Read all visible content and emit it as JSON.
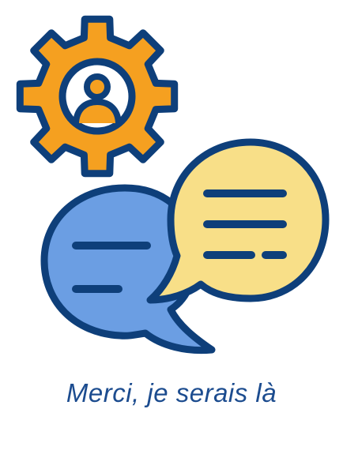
{
  "caption": {
    "text": "Merci, je serais là"
  },
  "icons": {
    "gear": "gear-user-icon",
    "user": "user-icon",
    "blue_bubble": "speech-bubble-left-icon",
    "yellow_bubble": "speech-bubble-right-icon"
  },
  "colors": {
    "outline": "#0e3f7a",
    "gear": "#f5a020",
    "gear_inner": "#ffffff",
    "bubble_blue": "#6b9ee3",
    "bubble_yellow": "#f8df88",
    "caption": "#1c4c8f"
  }
}
